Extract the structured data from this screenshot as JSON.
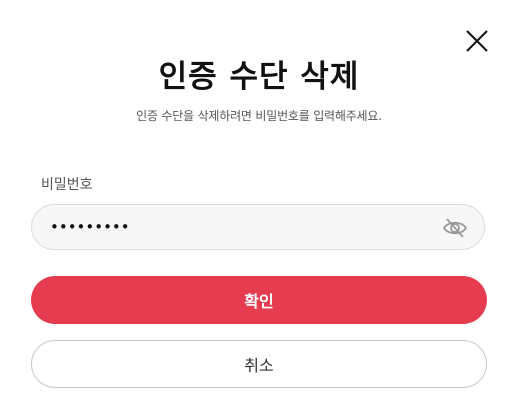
{
  "dialog": {
    "title": "인증 수단 삭제",
    "subtitle": "인증 수단을 삭제하려면 비밀번호를 입력해주세요.",
    "close_icon": "close-icon",
    "password": {
      "label": "비밀번호",
      "value": "•••••••••",
      "toggle_icon": "eye-slash-icon"
    },
    "confirm_label": "확인",
    "cancel_label": "취소"
  },
  "colors": {
    "accent": "#e63c50",
    "field_background": "#f7f7f7",
    "border": "#dddddd"
  }
}
